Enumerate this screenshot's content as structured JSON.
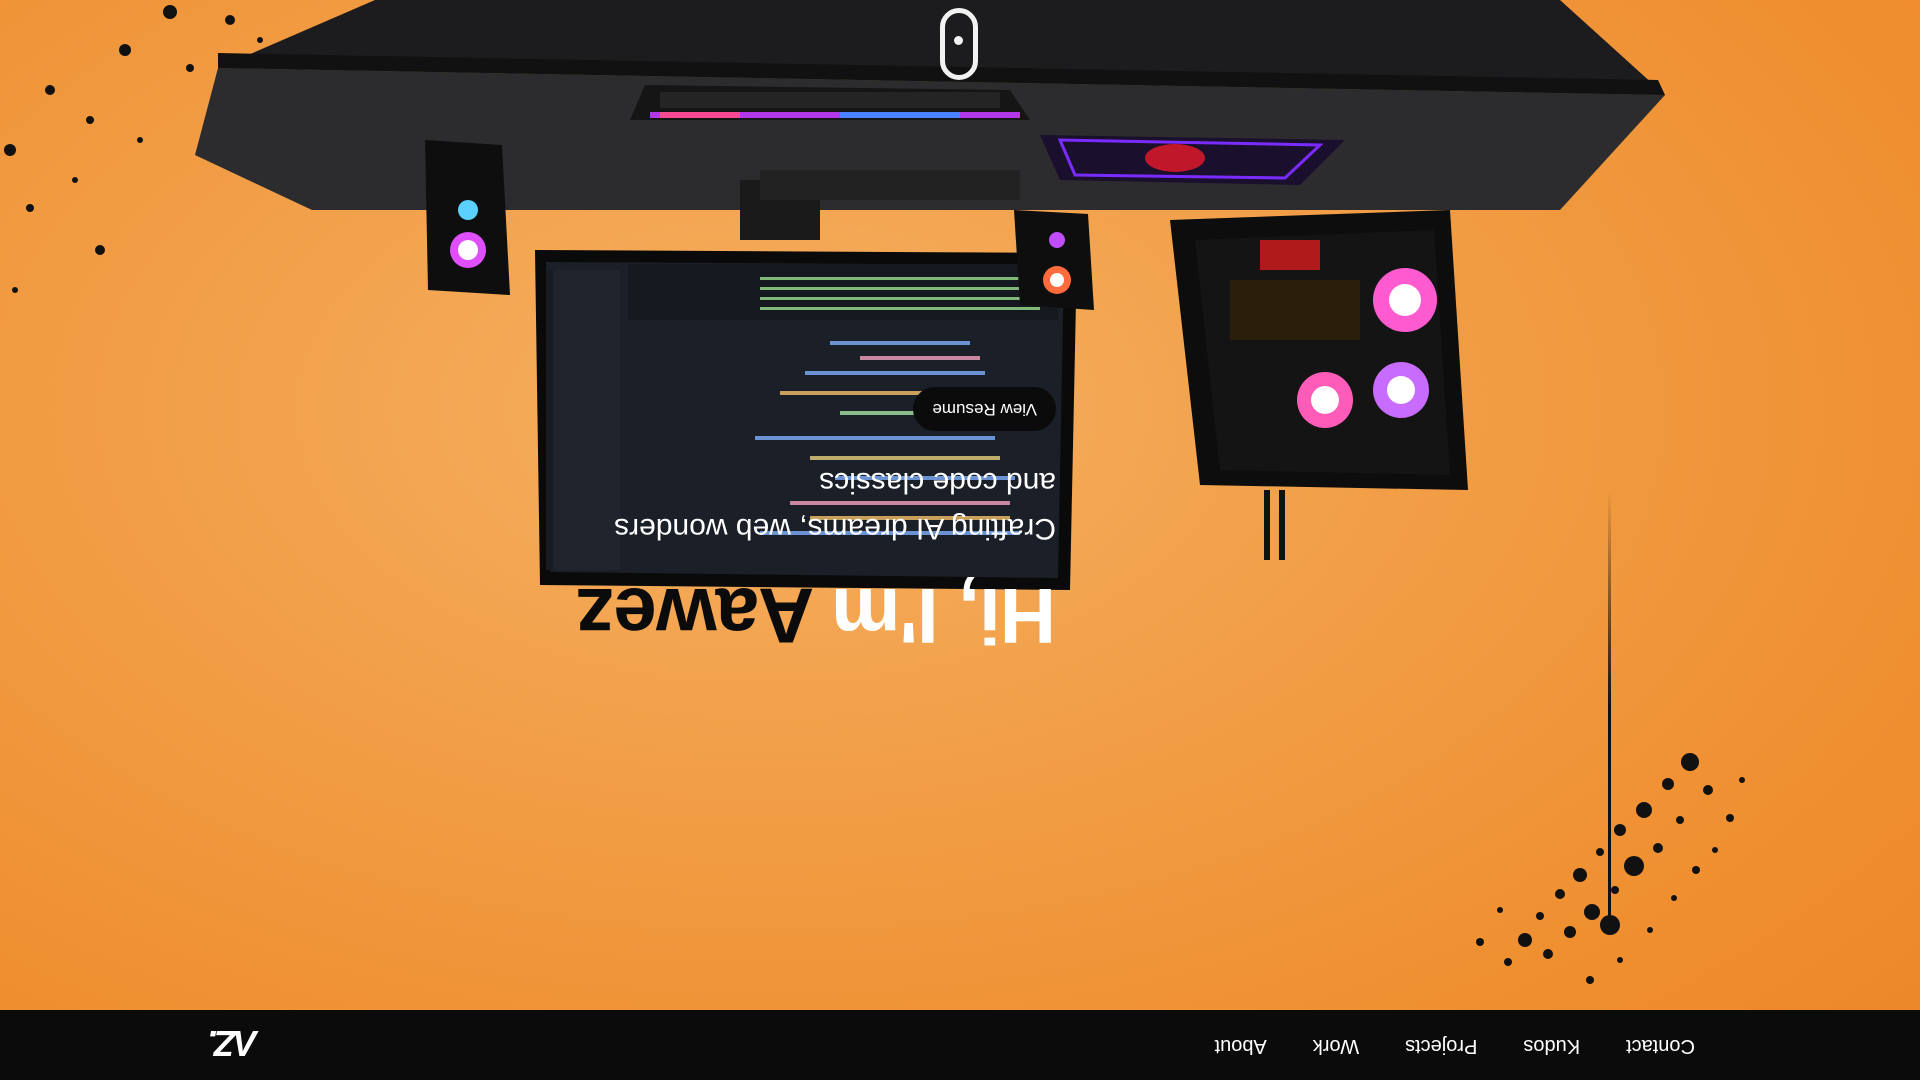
{
  "navbar": {
    "brand": "ΛZ.",
    "links": [
      "About",
      "Work",
      "Projects",
      "Kudos",
      "Contact"
    ]
  },
  "hero": {
    "greeting": "Hi, I'm ",
    "name": "Aawez",
    "tagline_line1": "Crafting AI dreams, web wonders",
    "tagline_line2": "and code classics",
    "resume_button": "View Resume"
  },
  "scene": {
    "description_icons": [
      "desk",
      "monitor",
      "keyboard",
      "mousepad",
      "speaker-left",
      "speaker-right",
      "pc-case"
    ],
    "colors": {
      "background": "#f39a3f",
      "dark": "#0b0b0b",
      "accent_purple": "#9b3cff"
    }
  }
}
